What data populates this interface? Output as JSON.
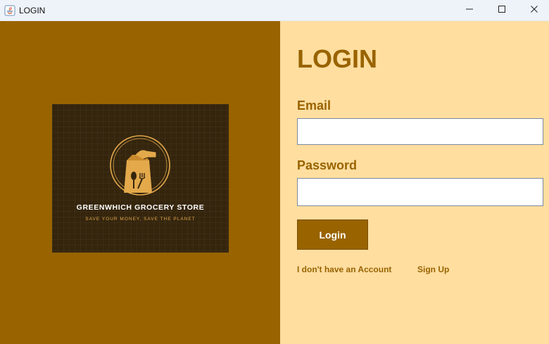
{
  "window": {
    "title": "LOGIN",
    "icons": [
      "java-app-icon",
      "minimize-icon",
      "maximize-icon",
      "close-icon"
    ]
  },
  "logo": {
    "name": "GREENWHICH GROCERY STORE",
    "tagline": "SAVE YOUR MONEY, SAVE THE PLANET",
    "icon": "grocery-bag-icon"
  },
  "form": {
    "heading": "LOGIN",
    "email_label": "Email",
    "email_value": "",
    "password_label": "Password",
    "password_value": "",
    "login_button": "Login",
    "no_account_text": "I don't have an Account",
    "signup_link": "Sign Up"
  },
  "colors": {
    "brand_brown": "#996300",
    "panel_cream": "#ffdea0",
    "logo_background": "#35250d",
    "logo_accent": "#e3a94b"
  }
}
